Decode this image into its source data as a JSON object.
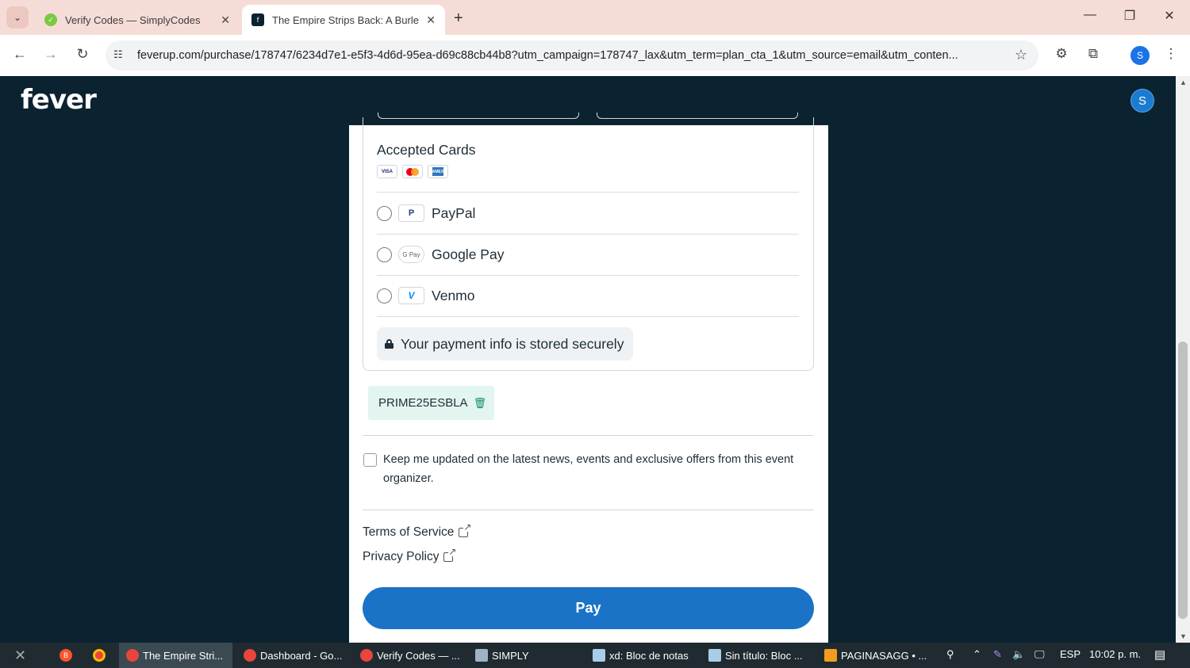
{
  "browser": {
    "tabs": [
      {
        "title": "Verify Codes — SimplyCodes",
        "favicon": "simplycodes-icon",
        "active": false
      },
      {
        "title": "The Empire Strips Back: A Burle",
        "favicon": "fever-icon",
        "active": true
      }
    ],
    "url": "feverup.com/purchase/178747/6234d7e1-e5f3-4d6d-95ea-d69c88cb44b8?utm_campaign=178747_lax&utm_term=plan_cta_1&utm_source=email&utm_conten...",
    "profile_initial": "S"
  },
  "page": {
    "logo": "fever",
    "avatar_initial": "S",
    "payment": {
      "accepted_cards_label": "Accepted Cards",
      "cards": [
        {
          "name": "visa",
          "label": "VISA"
        },
        {
          "name": "mastercard",
          "label": ""
        },
        {
          "name": "amex",
          "label": "AMEX"
        }
      ],
      "methods": [
        {
          "label": "PayPal",
          "icon": "paypal-icon",
          "logo_text": "PayPal"
        },
        {
          "label": "Google Pay",
          "icon": "google-pay-icon",
          "logo_text": "G Pay"
        },
        {
          "label": "Venmo",
          "icon": "venmo-icon",
          "logo_text": "V"
        }
      ],
      "secure_text": "Your payment info is stored securely"
    },
    "promo_code": "PRIME25ESBLA",
    "optin_text": "Keep me updated on the latest news, events and exclusive offers from this event organizer.",
    "terms_label": "Terms of Service",
    "privacy_label": "Privacy Policy",
    "pay_label": "Pay"
  },
  "taskbar": {
    "items": [
      {
        "label": "The Empire Stri...",
        "active": true
      },
      {
        "label": "Dashboard - Go...",
        "active": false
      },
      {
        "label": "Verify Codes — ...",
        "active": false
      },
      {
        "label": "SIMPLY",
        "active": false
      },
      {
        "label": "xd: Bloc de notas",
        "active": false
      },
      {
        "label": "Sin título: Bloc ...",
        "active": false
      },
      {
        "label": "PAGINASAGG • ...",
        "active": false
      }
    ],
    "language": "ESP",
    "time": "10:02 p. m."
  },
  "colors": {
    "page_bg": "#0b2230",
    "pay_button": "#1a73c7",
    "promo_bg": "#e3f5f0",
    "tabstrip_bg": "#f6dcd7"
  }
}
